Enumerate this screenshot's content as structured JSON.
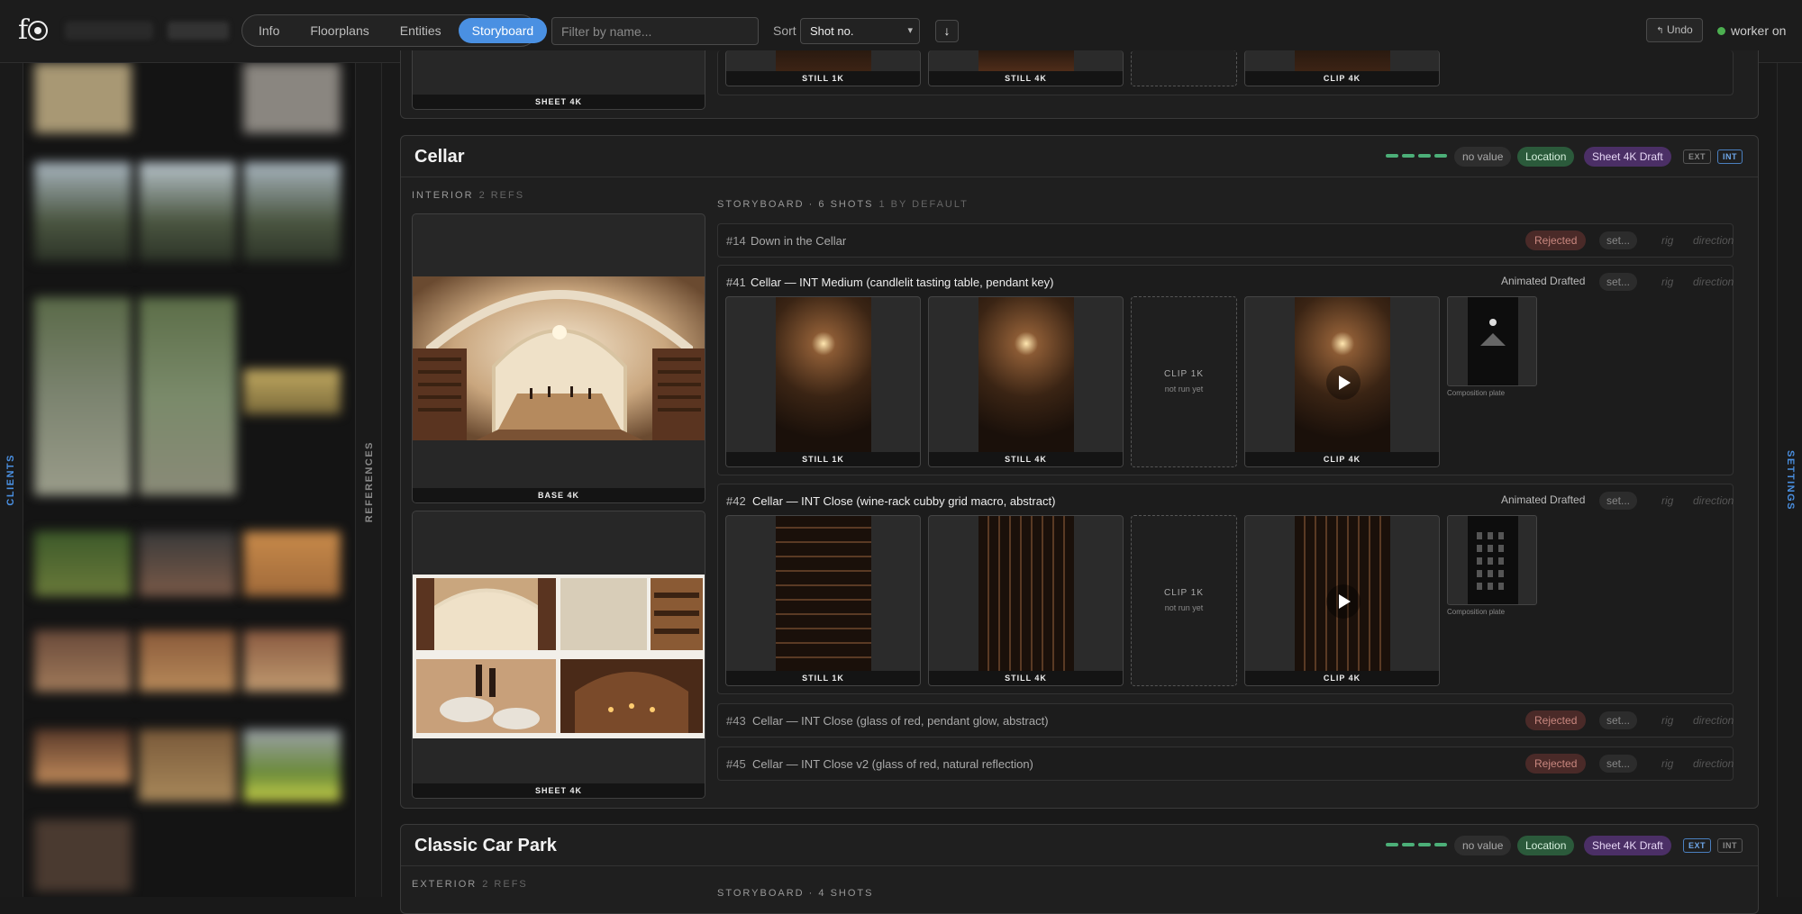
{
  "app": {
    "logo": "f"
  },
  "nav": {
    "tabs": [
      "Info",
      "Floorplans",
      "Entities",
      "Storyboard"
    ],
    "active_tab": "Storyboard"
  },
  "filter": {
    "placeholder": "Filter by name..."
  },
  "sort": {
    "label": "Sort",
    "value": "Shot no.",
    "direction": "↓"
  },
  "undo": {
    "label": "Undo",
    "icon": "undo-icon"
  },
  "worker": {
    "label": "worker on",
    "status_color": "#4caf50"
  },
  "rails": {
    "clients": "CLIENTS",
    "references": "REFERENCES",
    "settings": "SETTINGS"
  },
  "colors": {
    "accent": "#4a90e2",
    "location": "#2b5a3b",
    "sheet": "#4b2f66",
    "rejected": "#4a2a28",
    "progress": "#4caf78"
  },
  "previous_section": {
    "sheet_caption": "SHEET 4K",
    "thumbs": [
      "STILL 1K",
      "STILL 4K",
      "CLIP 4K"
    ]
  },
  "sections": [
    {
      "title": "Cellar",
      "no_value": "no value",
      "location": "Location",
      "sheet": "Sheet 4K Draft",
      "ext": "EXT",
      "int": "INT",
      "ref_label": "INTERIOR",
      "ref_count": "2 REFS",
      "refs": [
        {
          "caption": "BASE 4K"
        },
        {
          "caption": "SHEET 4K"
        }
      ],
      "storyboard_label": "STORYBOARD · 6 SHOTS",
      "storyboard_default": "1 BY DEFAULT",
      "shots": [
        {
          "num": "#14",
          "title": "Down in the Cellar",
          "status": "Rejected",
          "set": "set...",
          "rig": "rig",
          "direction": "direction"
        },
        {
          "num": "#41",
          "title": "Cellar — INT Medium (candlelit tasting table, pendant key)",
          "status": "Animated Drafted",
          "set": "set...",
          "rig": "rig",
          "direction": "direction",
          "thumbs": [
            "STILL 1K",
            "STILL 4K",
            "CLIP 4K"
          ],
          "placeholder": {
            "title": "CLIP 1K",
            "sub": "not run yet"
          },
          "plate_caption": "Composition plate"
        },
        {
          "num": "#42",
          "title": "Cellar — INT Close (wine-rack cubby grid macro, abstract)",
          "status": "Animated Drafted",
          "set": "set...",
          "rig": "rig",
          "direction": "direction",
          "thumbs": [
            "STILL 1K",
            "STILL 4K",
            "CLIP 4K"
          ],
          "placeholder": {
            "title": "CLIP 1K",
            "sub": "not run yet"
          },
          "plate_caption": "Composition plate"
        },
        {
          "num": "#43",
          "title": "Cellar — INT Close (glass of red, pendant glow, abstract)",
          "status": "Rejected",
          "set": "set...",
          "rig": "rig",
          "direction": "direction"
        },
        {
          "num": "#45",
          "title": "Cellar — INT Close v2 (glass of red, natural reflection)",
          "status": "Rejected",
          "set": "set...",
          "rig": "rig",
          "direction": "direction"
        }
      ]
    },
    {
      "title": "Classic Car Park",
      "no_value": "no value",
      "location": "Location",
      "sheet": "Sheet 4K Draft",
      "ext": "EXT",
      "int": "INT",
      "ref_label": "EXTERIOR",
      "ref_count": "2 REFS",
      "storyboard_label": "STORYBOARD · 4 SHOTS"
    }
  ]
}
